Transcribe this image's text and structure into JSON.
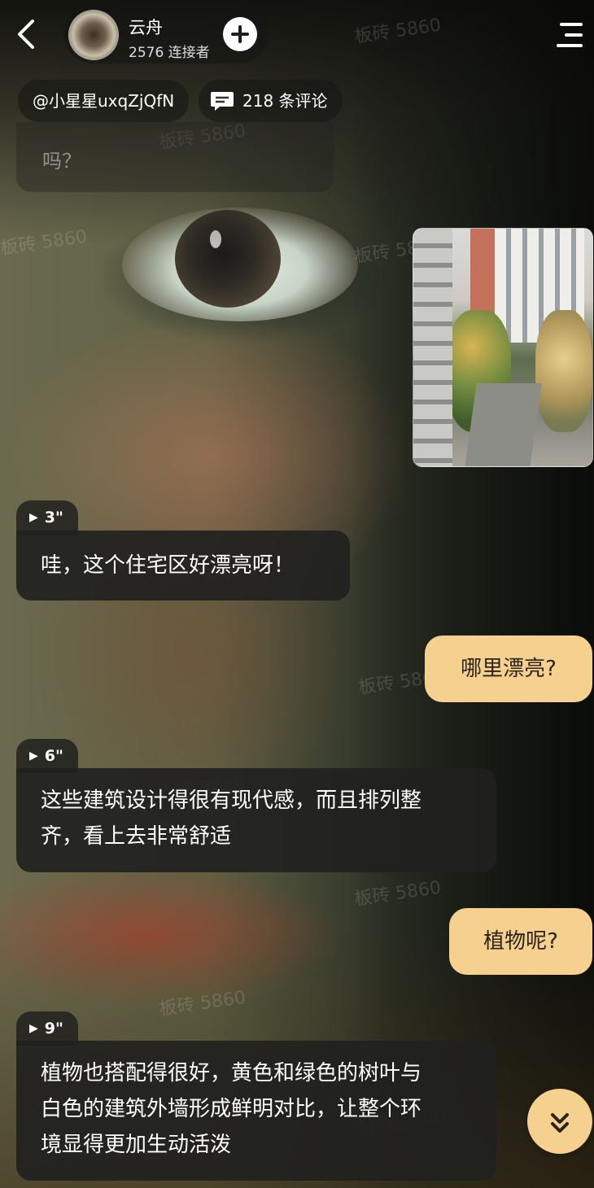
{
  "header": {
    "back_icon": "chevron-left-icon",
    "name": "云舟",
    "connections": "2576 连接者",
    "follow_icon": "plus-icon",
    "menu_icon": "menu-icon"
  },
  "info": {
    "creator": "@小星星uxqZjQfN",
    "comments": "218 条评论",
    "comment_icon": "comment-icon"
  },
  "watermark": "板砖 5860",
  "messages": {
    "partial": "吗？",
    "ai_1": {
      "duration": "3\"",
      "text": "哇，这个住宅区好漂亮呀！"
    },
    "user_1": "哪里漂亮?",
    "ai_2": {
      "duration": "6\"",
      "text_line1": "这些建筑设计得很有现代感，而且排列整",
      "text_line2": "齐，看上去非常舒适"
    },
    "user_2": "植物呢?",
    "ai_3": {
      "duration": "9\"",
      "text_line1": "植物也搭配得很好，黄色和绿色的树叶与",
      "text_line2": "白色的建筑外墙形成鲜明对比，让整个环",
      "text_line3": "境显得更加生动活泼"
    }
  },
  "scroll_icon": "double-chevron-down-icon",
  "colors": {
    "user_bubble": "#f5d08e",
    "ai_bubble": "#212121",
    "text": "#ffffff"
  }
}
